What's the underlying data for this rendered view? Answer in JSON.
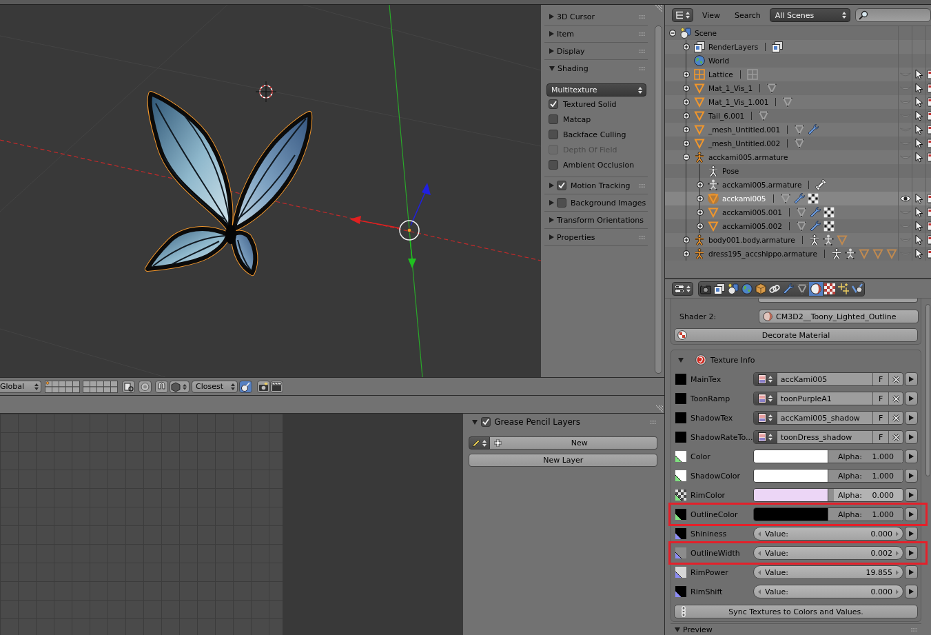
{
  "n_panel": {
    "panels": [
      {
        "title": "3D Cursor",
        "kind": "plain",
        "expanded": false,
        "grip": true
      },
      {
        "title": "Item",
        "kind": "plain",
        "expanded": false,
        "grip": true
      },
      {
        "title": "Display",
        "kind": "plain",
        "expanded": false,
        "grip": true
      },
      {
        "title": "Shading",
        "kind": "plain",
        "expanded": true,
        "grip": true,
        "dropdown": "Multitexture",
        "options": [
          {
            "label": "Textured Solid",
            "checked": true,
            "disabled": false
          },
          {
            "label": "Matcap",
            "checked": false,
            "disabled": false
          },
          {
            "label": "Backface Culling",
            "checked": false,
            "disabled": false
          },
          {
            "label": "Depth Of Field",
            "checked": false,
            "disabled": true
          },
          {
            "label": "Ambient Occlusion",
            "checked": false,
            "disabled": false
          }
        ]
      },
      {
        "title": "Motion Tracking",
        "kind": "toggle",
        "checked": true,
        "expanded": false,
        "grip": true
      },
      {
        "title": "Background Images",
        "kind": "toggle",
        "checked": false,
        "expanded": false,
        "grip": false
      },
      {
        "title": "Transform Orientations",
        "kind": "plain",
        "expanded": false,
        "grip": false
      },
      {
        "title": "Properties",
        "kind": "plain",
        "expanded": false,
        "grip": true
      }
    ]
  },
  "viewport_header": {
    "orientation": "Global",
    "snap_target": "Closest"
  },
  "grease_pencil": {
    "title": "Grease Pencil Layers",
    "checked": true,
    "expanded": true,
    "new_button": "New",
    "new_layer_button": "New Layer"
  },
  "outliner": {
    "menus": [
      "View",
      "Search"
    ],
    "filter": "All Scenes",
    "tree": [
      {
        "name": "Scene",
        "kind": "scene",
        "expanded": true,
        "selected": false,
        "children": [
          {
            "name": "RenderLayers",
            "kind": "render-layers",
            "expanded": false,
            "selected": false,
            "data": [
              {
                "kind": "render-layers"
              }
            ]
          },
          {
            "name": "World",
            "kind": "world",
            "selected": false
          },
          {
            "name": "Lattice",
            "kind": "lattice",
            "expanded": false,
            "selected": false,
            "visible": false,
            "data": [
              {
                "kind": "lattice-data"
              }
            ]
          },
          {
            "name": "Mat_1_Vis_1",
            "kind": "mesh",
            "expanded": false,
            "selected": false,
            "visible": false,
            "data": [
              {
                "kind": "mesh-data"
              }
            ]
          },
          {
            "name": "Mat_1_Vis_1.001",
            "kind": "mesh",
            "expanded": false,
            "selected": false,
            "visible": false,
            "data": [
              {
                "kind": "mesh-data"
              }
            ]
          },
          {
            "name": "Tail_6.001",
            "kind": "mesh",
            "expanded": false,
            "selected": false,
            "visible": false,
            "data": [
              {
                "kind": "mesh-data"
              }
            ]
          },
          {
            "name": "_mesh_Untitled.001",
            "kind": "mesh",
            "expanded": false,
            "selected": false,
            "visible": false,
            "data": [
              {
                "kind": "mesh-data"
              },
              {
                "kind": "modifier"
              }
            ]
          },
          {
            "name": "_mesh_Untitled.002",
            "kind": "mesh",
            "expanded": false,
            "selected": false,
            "visible": false,
            "data": [
              {
                "kind": "mesh-data"
              }
            ]
          },
          {
            "name": "acckami005.armature",
            "kind": "armature",
            "expanded": true,
            "selected": false,
            "visible": false,
            "children": [
              {
                "name": "Pose",
                "kind": "pose",
                "selected": false
              },
              {
                "name": "acckami005.armature",
                "kind": "armature-data",
                "expanded": false,
                "selected": false,
                "data": [
                  {
                    "kind": "bone"
                  }
                ]
              },
              {
                "name": "acckami005",
                "kind": "mesh",
                "expanded": false,
                "selected": true,
                "visible": true,
                "data": [
                  {
                    "kind": "mesh-data"
                  },
                  {
                    "kind": "modifier"
                  },
                  {
                    "kind": "vertex-groups"
                  }
                ]
              },
              {
                "name": "acckami005.001",
                "kind": "mesh",
                "expanded": false,
                "selected": false,
                "visible": false,
                "data": [
                  {
                    "kind": "mesh-data"
                  },
                  {
                    "kind": "modifier"
                  },
                  {
                    "kind": "vertex-groups"
                  }
                ]
              },
              {
                "name": "acckami005.002",
                "kind": "mesh",
                "expanded": false,
                "selected": false,
                "visible": false,
                "data": [
                  {
                    "kind": "mesh-data"
                  },
                  {
                    "kind": "modifier"
                  },
                  {
                    "kind": "vertex-groups"
                  }
                ]
              }
            ]
          },
          {
            "name": "body001.body.armature",
            "kind": "armature",
            "expanded": false,
            "selected": false,
            "visible": false,
            "data": [
              {
                "kind": "pose"
              },
              {
                "kind": "armature-data"
              },
              {
                "kind": "mesh-object"
              }
            ]
          },
          {
            "name": "dress195_accshippo.armature",
            "kind": "armature",
            "expanded": false,
            "selected": false,
            "visible": false,
            "data": [
              {
                "kind": "pose"
              },
              {
                "kind": "armature-data"
              },
              {
                "kind": "mesh-object"
              },
              {
                "kind": "mesh-object"
              },
              {
                "kind": "mesh-object"
              }
            ]
          }
        ]
      }
    ]
  },
  "properties": {
    "tabs": [
      {
        "kind": "render",
        "selected": false
      },
      {
        "kind": "render-layers",
        "selected": false
      },
      {
        "kind": "scene",
        "selected": false
      },
      {
        "kind": "world",
        "selected": false
      },
      {
        "kind": "object",
        "selected": false
      },
      {
        "kind": "constraints",
        "selected": false
      },
      {
        "kind": "modifiers",
        "selected": false
      },
      {
        "kind": "data",
        "selected": false
      },
      {
        "kind": "material",
        "selected": true
      },
      {
        "kind": "texture",
        "selected": false
      },
      {
        "kind": "particles",
        "selected": false
      },
      {
        "kind": "physics",
        "selected": false
      }
    ],
    "shader_2": {
      "label": "Shader 2:",
      "value": "CM3D2__Toony_Lighted_Outline"
    },
    "decorate_button": "Decorate Material",
    "texture_info": {
      "title": "Texture Info",
      "expanded": true,
      "rows": [
        {
          "kind": "texture",
          "label": "MainTex",
          "color": "#000000",
          "checker": false,
          "image": "accKami005",
          "flag": "F",
          "highlighted": false
        },
        {
          "kind": "texture",
          "label": "ToonRamp",
          "color": "#000000",
          "checker": false,
          "image": "toonPurpleA1",
          "flag": "F",
          "highlighted": false
        },
        {
          "kind": "texture",
          "label": "ShadowTex",
          "color": "#000000",
          "checker": false,
          "image": "accKami005_shadow",
          "flag": "F",
          "highlighted": false
        },
        {
          "kind": "texture",
          "label": "ShadowRateTo...",
          "color": "#000000",
          "checker": false,
          "image": "toonDress_shadow",
          "flag": "F",
          "highlighted": false
        },
        {
          "kind": "color",
          "label": "Color",
          "color": "#ffffff",
          "checker": false,
          "alpha_label": "Alpha:",
          "alpha": "1.000",
          "level": 1,
          "highlighted": false
        },
        {
          "kind": "color",
          "label": "ShadowColor",
          "color": "#ffffff",
          "checker": false,
          "alpha_label": "Alpha:",
          "alpha": "1.000",
          "level": 1,
          "highlighted": false
        },
        {
          "kind": "color",
          "label": "RimColor",
          "color": "#ecd6f6",
          "checker": true,
          "alpha_label": "Alpha:",
          "alpha": "0.000",
          "level": 0,
          "highlighted": false
        },
        {
          "kind": "color",
          "label": "OutlineColor",
          "color": "#000000",
          "checker": false,
          "alpha_label": "Alpha:",
          "alpha": "1.000",
          "level": 1,
          "highlighted": true
        },
        {
          "kind": "float",
          "label": "Shininess",
          "color": "#000000",
          "checker": false,
          "value_label": "Value:",
          "value": "0.000",
          "highlighted": false
        },
        {
          "kind": "float",
          "label": "OutlineWidth",
          "color": "#8c8c8c",
          "checker": false,
          "value_label": "Value:",
          "value": "0.002",
          "highlighted": true
        },
        {
          "kind": "float",
          "label": "RimPower",
          "color": "#d6d6d6",
          "checker": false,
          "value_label": "Value:",
          "value": "19.855",
          "highlighted": false
        },
        {
          "kind": "float",
          "label": "RimShift",
          "color": "#000000",
          "checker": false,
          "value_label": "Value:",
          "value": "0.000",
          "highlighted": false
        }
      ],
      "sync_button": "Sync Textures to Colors and Values."
    },
    "preview": {
      "title": "Preview",
      "expanded": true
    }
  }
}
